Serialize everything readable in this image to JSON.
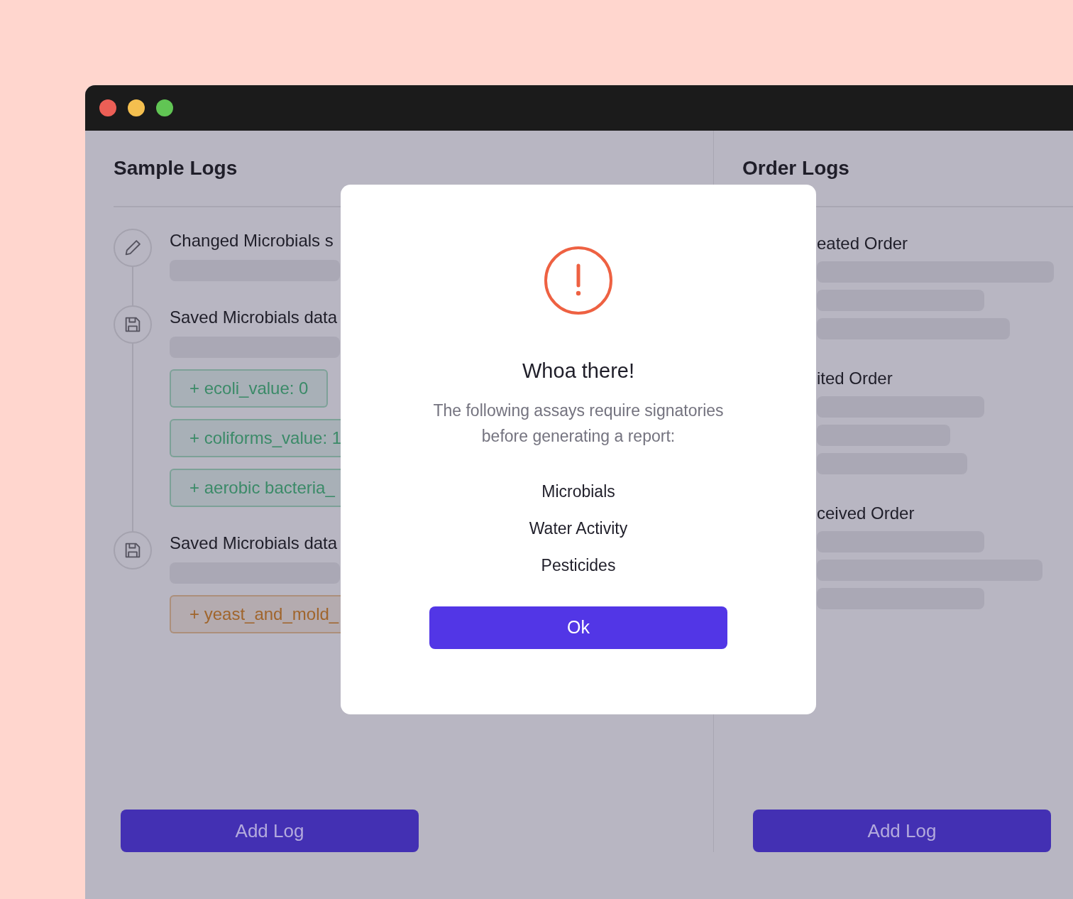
{
  "window": {
    "controls": [
      {
        "color": "#ec5f56"
      },
      {
        "color": "#f4bf4f"
      },
      {
        "color": "#61c554"
      }
    ]
  },
  "sample_logs": {
    "title": "Sample Logs",
    "entries": [
      {
        "kind": "edit",
        "text": "Changed Microbials s"
      },
      {
        "kind": "save",
        "text": "Saved Microbials data",
        "tags": [
          {
            "text": "+ ecoli_value: 0",
            "color": "#3b8a68"
          },
          {
            "text": "+ coliforms_value: 1",
            "color": "#3b8a68"
          },
          {
            "text": "+ aerobic bacteria_",
            "color": "#3b8a68"
          }
        ]
      },
      {
        "kind": "save",
        "text": "Saved Microbials data",
        "tags": [
          {
            "text": "+ yeast_and_mold_",
            "color": "#a0652c"
          }
        ]
      }
    ],
    "add_button": "Add Log"
  },
  "order_logs": {
    "title": "Order Logs",
    "entries": [
      {
        "text": "eated Order"
      },
      {
        "text": "ited Order"
      },
      {
        "text": "ceived Order"
      }
    ],
    "add_button": "Add Log"
  },
  "dialog": {
    "title": "Whoa there!",
    "message": "The following assays require signatories before generating a report:",
    "assays": [
      "Microbials",
      "Water Activity",
      "Pesticides"
    ],
    "button": "Ok"
  }
}
